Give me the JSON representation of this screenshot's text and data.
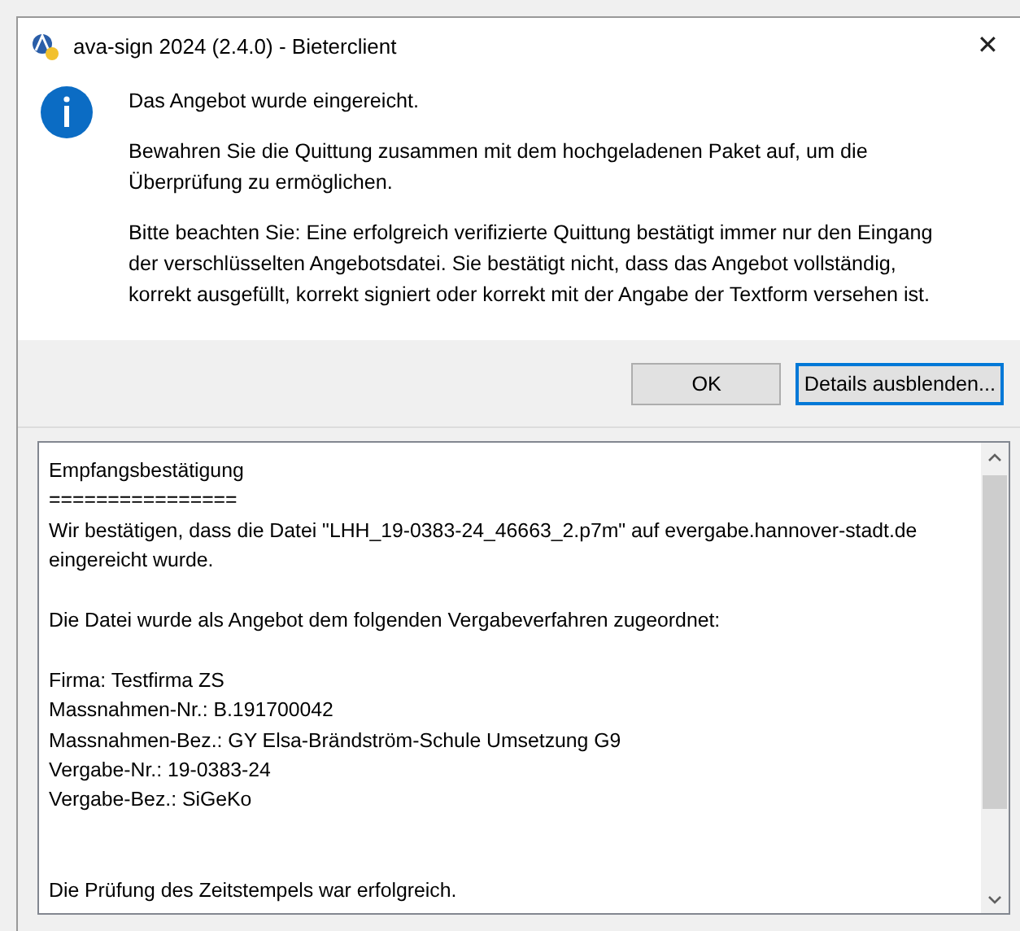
{
  "window": {
    "title": "ava-sign 2024 (2.4.0) - Bieterclient",
    "close": "✕"
  },
  "message": {
    "heading": "Das Angebot wurde eingereicht.",
    "paragraphs": [
      "Bewahren Sie die Quittung zusammen mit dem hochgeladenen Paket auf, um die Überprüfung zu ermöglichen.",
      "Bitte beachten Sie: Eine erfolgreich verifizierte Quittung bestätigt immer nur den Eingang der verschlüsselten Angebotsdatei. Sie bestätigt nicht, dass das Angebot vollständig, korrekt ausgefüllt, korrekt signiert oder korrekt mit der Angabe der Textform versehen ist."
    ]
  },
  "buttons": [
    {
      "label": "OK",
      "focused": false
    },
    {
      "label": "Details ausblenden...",
      "focused": true
    }
  ],
  "details": {
    "blocks": [
      [
        "Empfangsbestätigung",
        "================",
        "Wir bestätigen, dass die Datei \"LHH_19-0383-24_46663_2.p7m\" auf evergabe.hannover-stadt.de eingereicht wurde."
      ],
      [
        "Die Datei wurde als Angebot dem folgenden Vergabeverfahren zugeordnet:"
      ],
      [
        "Firma: Testfirma ZS",
        "Massnahmen-Nr.: B.191700042",
        "Massnahmen-Bez.: GY Elsa-Brändström-Schule Umsetzung G9",
        "Vergabe-Nr.: 19-0383-24",
        "Vergabe-Bez.: SiGeKo"
      ],
      [
        "Die Prüfung des Zeitstempels war erfolgreich."
      ]
    ]
  }
}
